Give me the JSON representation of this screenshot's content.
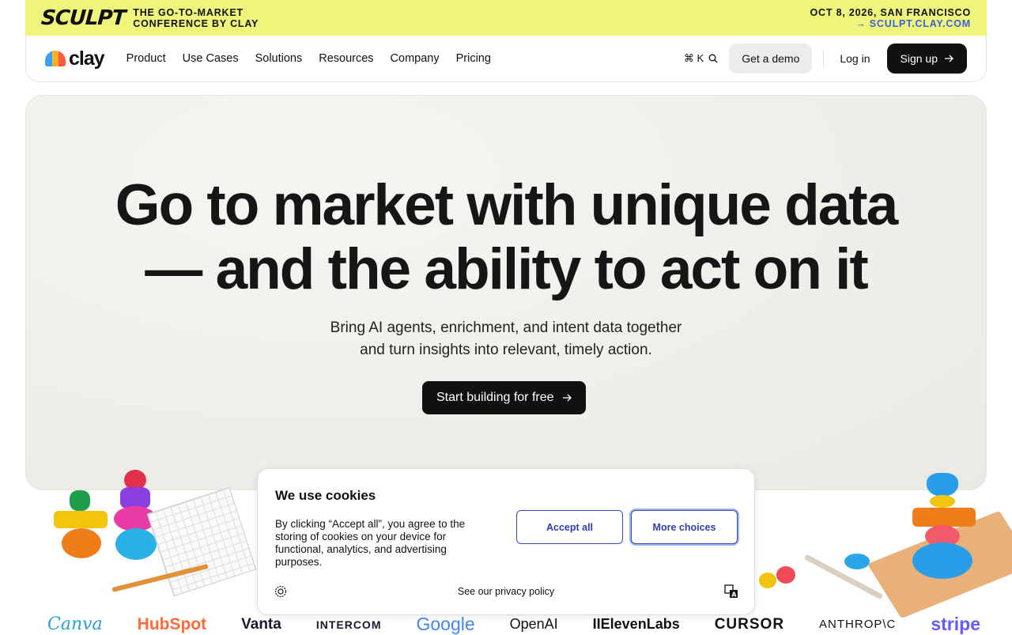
{
  "banner": {
    "logo_text": "SCULPT",
    "title_line1": "THE GO-TO-MARKET",
    "title_line2": "CONFERENCE BY CLAY",
    "date": "OCT 8, 2026, SAN FRANCISCO",
    "link": "→ SCULPT.CLAY.COM",
    "link_color": "#3c5fd8",
    "background": "#eef57a"
  },
  "nav": {
    "brand": "clay",
    "links": [
      "Product",
      "Use Cases",
      "Solutions",
      "Resources",
      "Company",
      "Pricing"
    ],
    "search_shortcut": "⌘ K",
    "search_icon": "search-icon",
    "demo_label": "Get a demo",
    "login_label": "Log in",
    "signup_label": "Sign up",
    "signup_icon": "arrow-right-icon"
  },
  "hero": {
    "headline_line1": "Go to market with unique data",
    "headline_line2": "— and the ability to act on it",
    "subtitle_line1": "Bring AI agents, enrichment, and intent data together",
    "subtitle_line2": "and turn insights into relevant, timely action.",
    "cta_label": "Start building for free",
    "cta_icon": "arrow-right-icon"
  },
  "cookie": {
    "title": "We use cookies",
    "message": "By clicking “Accept all”, you agree to the storing of cookies on your device for functional, analytics, and advertising purposes.",
    "accept_label": "Accept all",
    "more_label": "More choices",
    "policy_label": "See our privacy policy",
    "settings_icon": "cookie-settings-icon",
    "language_icon": "translate-icon",
    "accent": "#2f3fb0"
  },
  "customer_logos": [
    "Canva",
    "HubSpot",
    "Vanta",
    "INTERCOM",
    "Google",
    "OpenAI",
    "IIElevenLabs",
    "CURSOR",
    "ANTHROP\\C",
    "stripe"
  ]
}
